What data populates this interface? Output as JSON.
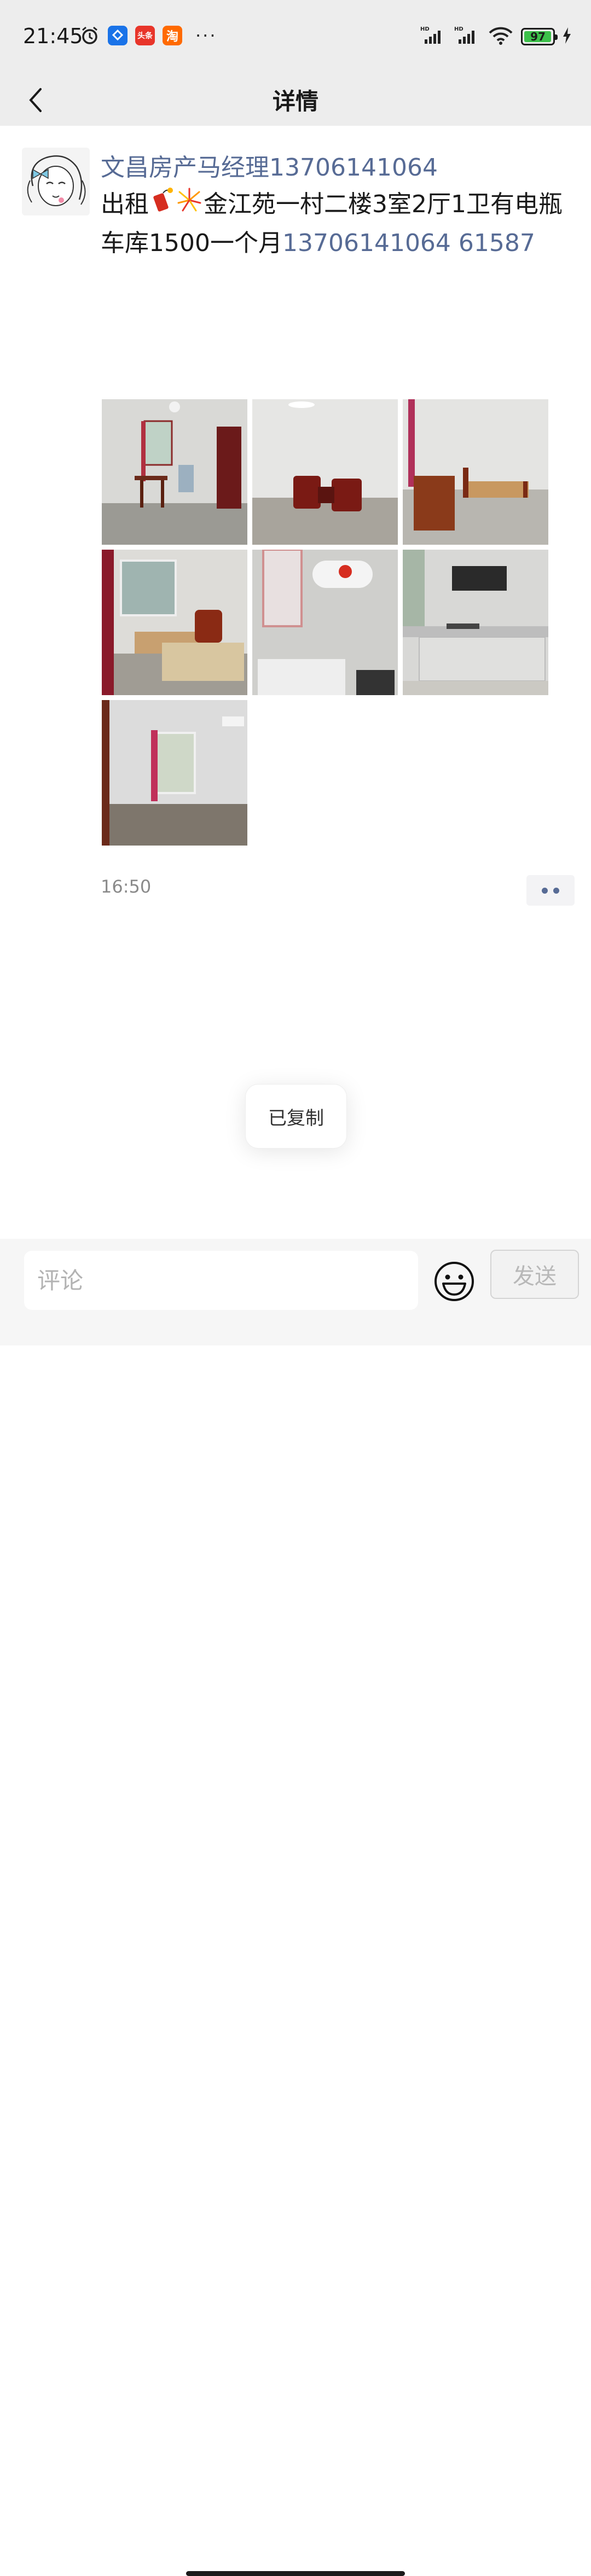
{
  "status_bar": {
    "time": "21:45",
    "apps": [
      {
        "icon": "app-blue-icon",
        "color": "#1a73e8",
        "label": ""
      },
      {
        "icon": "toutiao-app-icon",
        "color": "#e8352a",
        "label": "头条"
      },
      {
        "icon": "taobao-app-icon",
        "color": "#ff6a00",
        "label": "淘"
      }
    ],
    "more": "···",
    "battery_level": "97",
    "battery_fraction": 0.97
  },
  "header": {
    "title": "详情"
  },
  "post": {
    "author": "文昌房产马经理13706141064",
    "content_prefix": "出租",
    "content_main": "金江苑一村二楼3室2厅1卫有电瓶车库1500一个月",
    "content_phone": "13706141064 61587",
    "time": "16:50",
    "photos": [
      {
        "name": "living-room-photo"
      },
      {
        "name": "sofa-room-photo"
      },
      {
        "name": "bedroom-bed-photo"
      },
      {
        "name": "bedroom-two-beds-photo"
      },
      {
        "name": "bathroom-photo"
      },
      {
        "name": "kitchen-photo"
      },
      {
        "name": "empty-room-photo"
      }
    ]
  },
  "toast": {
    "text": "已复制"
  },
  "comment_bar": {
    "placeholder": "评论",
    "send_label": "发送"
  },
  "colors": {
    "link": "#576b95",
    "bar_bg": "#ededed",
    "battery_fill": "#3cc04a"
  }
}
